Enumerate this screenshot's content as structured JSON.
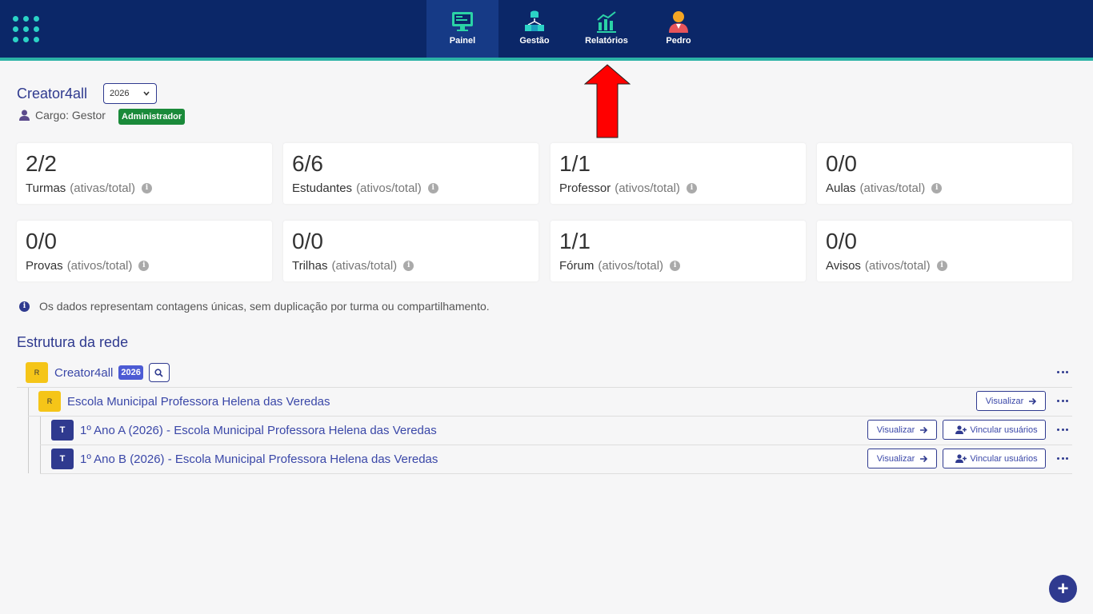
{
  "nav": {
    "items": [
      {
        "label": "Painel",
        "icon": "monitor-icon"
      },
      {
        "label": "Gestão",
        "icon": "network-icon"
      },
      {
        "label": "Relatórios",
        "icon": "chart-icon"
      },
      {
        "label": "Pedro",
        "icon": "user-avatar-icon"
      }
    ],
    "active": "Painel"
  },
  "header": {
    "org": "Creator4all",
    "year": "2026",
    "role_label": "Cargo: Gestor",
    "role_badge": "Administrador"
  },
  "stats": [
    {
      "value": "2/2",
      "label": "Turmas",
      "suffix": "(ativas/total)"
    },
    {
      "value": "6/6",
      "label": "Estudantes",
      "suffix": "(ativos/total)"
    },
    {
      "value": "1/1",
      "label": "Professor",
      "suffix": "(ativos/total)"
    },
    {
      "value": "0/0",
      "label": "Aulas",
      "suffix": "(ativas/total)"
    },
    {
      "value": "0/0",
      "label": "Provas",
      "suffix": "(ativos/total)"
    },
    {
      "value": "0/0",
      "label": "Trilhas",
      "suffix": "(ativas/total)"
    },
    {
      "value": "1/1",
      "label": "Fórum",
      "suffix": "(ativos/total)"
    },
    {
      "value": "0/0",
      "label": "Avisos",
      "suffix": "(ativos/total)"
    }
  ],
  "note": "Os dados representam contagens únicas, sem duplicação por turma ou compartilhamento.",
  "structure": {
    "title": "Estrutura da rede",
    "root": {
      "avatar": "R",
      "label": "Creator4all",
      "year": "2026"
    },
    "school": {
      "avatar": "R",
      "label": "Escola Municipal Professora Helena das Veredas",
      "action": "Visualizar"
    },
    "classes": [
      {
        "avatar": "T",
        "label": "1º Ano A (2026) - Escola Municipal Professora Helena das Veredas",
        "action": "Visualizar",
        "link": "Vincular usuários"
      },
      {
        "avatar": "T",
        "label": "1º Ano B (2026) - Escola Municipal Professora Helena das Veredas",
        "action": "Visualizar",
        "link": "Vincular usuários"
      }
    ]
  },
  "fab": "+",
  "colors": {
    "navbar": "#0b2768",
    "accent": "#2bb3a6",
    "primary": "#2f3a8f",
    "badge_green": "#1a8a3a",
    "arrow": "#ff0000"
  }
}
